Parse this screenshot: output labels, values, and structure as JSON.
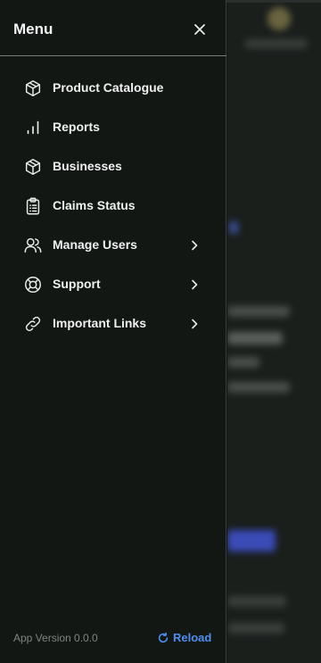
{
  "menu": {
    "title": "Menu",
    "close_icon": "close-icon",
    "items": [
      {
        "label": "Product Catalogue",
        "icon": "box-icon",
        "has_submenu": false
      },
      {
        "label": "Reports",
        "icon": "bar-chart-icon",
        "has_submenu": false
      },
      {
        "label": "Businesses",
        "icon": "box-icon",
        "has_submenu": false
      },
      {
        "label": "Claims Status",
        "icon": "clipboard-icon",
        "has_submenu": false
      },
      {
        "label": "Manage Users",
        "icon": "users-icon",
        "has_submenu": true
      },
      {
        "label": "Support",
        "icon": "lifebuoy-icon",
        "has_submenu": true
      },
      {
        "label": "Important Links",
        "icon": "link-icon",
        "has_submenu": true
      }
    ]
  },
  "footer": {
    "app_version": "App Version 0.0.0",
    "reload_label": "Reload",
    "reload_icon": "refresh-icon"
  },
  "colors": {
    "drawer_bg": "#121714",
    "text": "#eef1ef",
    "muted": "#7e8682",
    "accent": "#4d8ef0"
  }
}
